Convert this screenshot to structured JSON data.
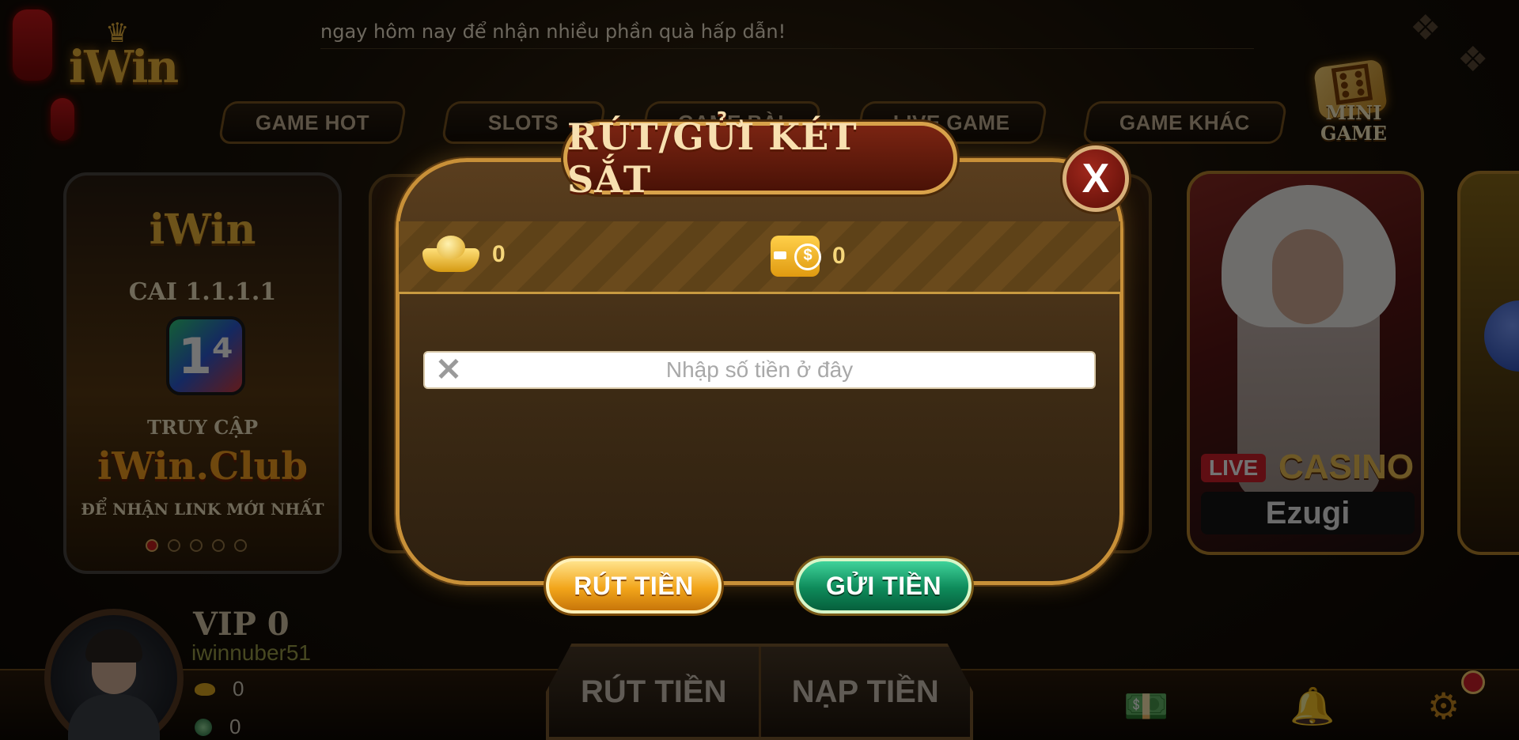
{
  "header": {
    "logo_text": "iWin",
    "marquee": "ngay hôm nay để nhận nhiều phần quà hấp dẫn!"
  },
  "tabs": [
    {
      "label": "GAME HOT"
    },
    {
      "label": "SLOTS"
    },
    {
      "label": "GAME BÀI"
    },
    {
      "label": "LIVE GAME"
    },
    {
      "label": "GAME KHÁC"
    }
  ],
  "minigame": {
    "label_line1": "MINI",
    "label_line2": "GAME"
  },
  "promo_card": {
    "logo": "iWin",
    "line1": "CAI 1.1.1.1",
    "badge": "1⁴",
    "line2": "TRUY CẬP",
    "club": "iWin.Club",
    "line3": "ĐỂ NHẬN LINK MỚI NHẤT",
    "dots_total": 5,
    "dots_active": 1
  },
  "live_card": {
    "live": "LIVE",
    "casino": "CASINO",
    "provider": "Ezugi"
  },
  "player": {
    "vip": "VIP 0",
    "username": "iwinnuber51",
    "gold": "0",
    "gems": "0"
  },
  "bottom_actions": {
    "withdraw": "RÚT TIỀN",
    "deposit": "NẠP TIỀN"
  },
  "modal": {
    "title": "RÚT/GỬI KÉT SẮT",
    "close_label": "X",
    "safe_balance": "0",
    "wallet_balance": "0",
    "input_placeholder": "Nhập số tiền ở đây",
    "input_value": "",
    "withdraw_button": "RÚT TIỀN",
    "deposit_button": "GỬI TIỀN"
  },
  "colors": {
    "gold_accent": "#c89038",
    "withdraw_button": "#f2a51a",
    "deposit_button": "#0e8a5a",
    "title_plate": "#7a2412"
  }
}
